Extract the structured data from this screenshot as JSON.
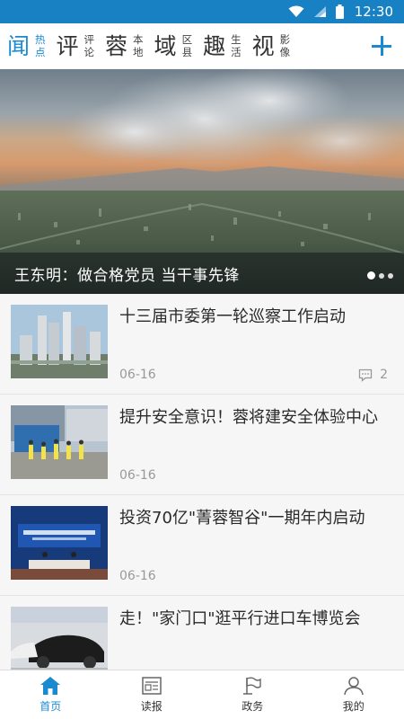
{
  "status_bar": {
    "time": "12:30"
  },
  "channels": [
    {
      "main": "闻",
      "sub": [
        "热",
        "点"
      ]
    },
    {
      "main": "评",
      "sub": [
        "评",
        "论"
      ]
    },
    {
      "main": "蓉",
      "sub": [
        "本",
        "地"
      ]
    },
    {
      "main": "域",
      "sub": [
        "区",
        "县"
      ]
    },
    {
      "main": "趣",
      "sub": [
        "生",
        "活"
      ]
    },
    {
      "main": "视",
      "sub": [
        "影",
        "像"
      ]
    }
  ],
  "hero": {
    "caption": "王东明：做合格党员 当干事先锋",
    "active_slide": 1,
    "slide_count": 3
  },
  "news": [
    {
      "title": "十三届市委第一轮巡察工作启动",
      "date": "06-16",
      "comments": "2"
    },
    {
      "title": "提升安全意识！蓉将建安全体验中心",
      "date": "06-16"
    },
    {
      "title": "投资70亿\"菁蓉智谷\"一期年内启动",
      "date": "06-16"
    },
    {
      "title": "走！\"家门口\"逛平行进口车博览会",
      "date": ""
    }
  ],
  "tabs": [
    {
      "label": "首页",
      "icon": "home-icon",
      "active": true
    },
    {
      "label": "读报",
      "icon": "newspaper-icon",
      "active": false
    },
    {
      "label": "政务",
      "icon": "flag-icon",
      "active": false
    },
    {
      "label": "我的",
      "icon": "person-icon",
      "active": false
    }
  ],
  "colors": {
    "accent": "#1a8ad0",
    "status_bar": "#1781c4"
  }
}
